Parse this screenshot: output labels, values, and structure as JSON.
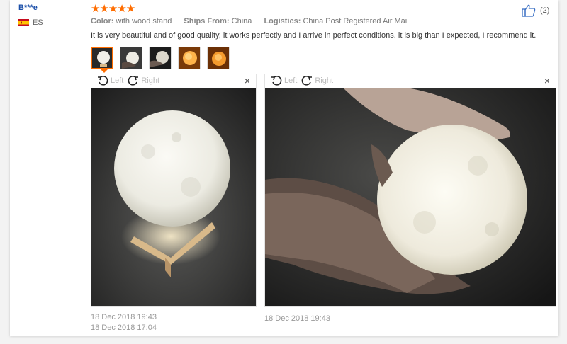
{
  "reviewer": {
    "name": "B***e",
    "country_code": "ES"
  },
  "rating": {
    "stars": 5,
    "star_glyphs": "★★★★★"
  },
  "meta": {
    "color_label": "Color:",
    "color_value": "with wood stand",
    "ships_label": "Ships From:",
    "ships_value": "China",
    "logistics_label": "Logistics:",
    "logistics_value": "China Post Registered Air Mail"
  },
  "review_text": "It is very beautiful and of good quality, it works perfectly and I arrive in perfect conditions. it is big than I expected, I recommend it.",
  "helpful": {
    "count": "(2)",
    "icon": "thumbs-up-icon"
  },
  "thumbnails": [
    {
      "name": "moon lamp white",
      "active": true
    },
    {
      "name": "moon lamp hand"
    },
    {
      "name": "moon lamp dark"
    },
    {
      "name": "moon lamp orange"
    },
    {
      "name": "moon lamp orange 2"
    }
  ],
  "viewer_left": {
    "rotate_left": "Left",
    "rotate_right": "Right",
    "close": "×"
  },
  "viewer_right": {
    "rotate_left": "Left",
    "rotate_right": "Right",
    "close": "×"
  },
  "dates": {
    "left_1": "18 Dec 2018 19:43",
    "left_2": "18 Dec 2018 17:04",
    "right_1": "18 Dec 2018 19:43"
  },
  "colors": {
    "accent": "#ff6d00",
    "link": "#1a4ea8"
  }
}
